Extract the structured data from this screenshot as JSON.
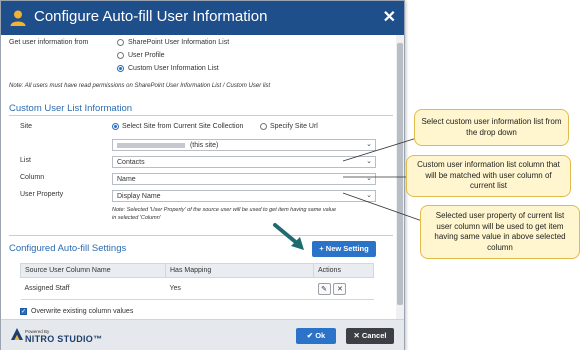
{
  "dialog": {
    "title": "Configure Auto-fill User Information",
    "close_glyph": "✕"
  },
  "source": {
    "label": "Get user information from",
    "options": [
      "SharePoint User Information List",
      "User Profile",
      "Custom User Information List"
    ],
    "selected_index": 2,
    "note": "Note: All users must have read permissions on SharePoint User Information List / Custom User list"
  },
  "custom_list": {
    "heading": "Custom User List Information",
    "site_label": "Site",
    "site_options": [
      "Select Site from Current Site Collection",
      "Specify Site Url"
    ],
    "site_selected_index": 0,
    "site_value": "(this site)",
    "list_label": "List",
    "list_value": "Contacts",
    "column_label": "Column",
    "column_value": "Name",
    "user_property_label": "User Property",
    "user_property_value": "Display Name",
    "property_note_line1": "Note: Selected 'User Property' of the source user will be used to get item having same value",
    "property_note_line2": "in selected 'Column'"
  },
  "configured": {
    "heading": "Configured Auto-fill Settings",
    "new_setting_label": "New Setting",
    "columns": [
      "Source User Column Name",
      "Has Mapping",
      "Actions"
    ],
    "rows": [
      {
        "name": "Assigned Staff",
        "has_mapping": "Yes"
      }
    ]
  },
  "overwrite": {
    "label": "Overwrite existing column values",
    "checked": true
  },
  "footer": {
    "powered_by": "Powered By",
    "brand": "NITRO STUDIO™",
    "ok_label": "Ok",
    "cancel_label": "Cancel"
  },
  "callouts": [
    "Select custom user information list from the drop down",
    "Custom user information list column that will be matched with user column of current list",
    "Selected user property of current list user column will be used to get item having same value in above selected column"
  ],
  "colors": {
    "title_bar": "#1f4f8b",
    "accent": "#2a73c9",
    "section_heading": "#2b6cb0",
    "callout_fill": "#fff6cf",
    "callout_border": "#e0bc4e",
    "arrow": "#1e6b70"
  },
  "icons": [
    "user-icon",
    "close-icon",
    "chevron-down-icon",
    "plus-icon",
    "edit-icon",
    "delete-icon",
    "check-icon",
    "nitro-logo-icon"
  ]
}
